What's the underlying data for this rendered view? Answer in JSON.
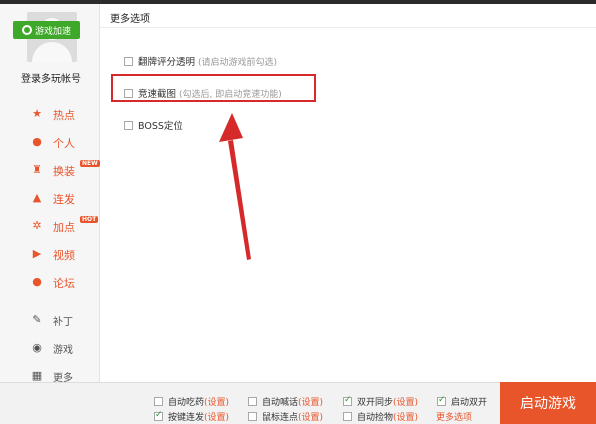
{
  "sidebar": {
    "login_label": "登录多玩帐号",
    "items": [
      {
        "label": "热点",
        "icon": "star-icon",
        "glyph": "★"
      },
      {
        "label": "个人",
        "icon": "person-icon",
        "glyph": "●"
      },
      {
        "label": "换装",
        "icon": "shirt-icon",
        "glyph": "♜",
        "badge": "NEW"
      },
      {
        "label": "连发",
        "icon": "triangle-icon",
        "glyph": "▲"
      },
      {
        "label": "加点",
        "icon": "crosshair-icon",
        "glyph": "✲",
        "badge": "HOT"
      },
      {
        "label": "视频",
        "icon": "play-icon",
        "glyph": "▶"
      },
      {
        "label": "论坛",
        "icon": "chat-icon",
        "glyph": "●"
      },
      {
        "label": "补丁",
        "icon": "wrench-icon",
        "glyph": "✎"
      },
      {
        "label": "游戏",
        "icon": "gamepad-icon",
        "glyph": "◉"
      },
      {
        "label": "更多",
        "icon": "grid-icon",
        "glyph": "▦"
      }
    ]
  },
  "content": {
    "title": "更多选项",
    "options": [
      {
        "label": "翻牌评分透明",
        "hint": "(请启动游戏前勾选)",
        "checked": false
      },
      {
        "label": "竞速截图",
        "hint": "(勾选后, 即启动竞速功能)",
        "checked": false
      },
      {
        "label": "BOSS定位",
        "hint": "",
        "checked": false
      }
    ]
  },
  "bottom": {
    "accel_label": "游戏加速",
    "options_row1": [
      {
        "label": "自动吃药",
        "set": "(设置)",
        "checked": false
      },
      {
        "label": "自动喊话",
        "set": "(设置)",
        "checked": false
      },
      {
        "label": "双开同步",
        "set": "(设置)",
        "checked": true
      },
      {
        "label": "启动双开",
        "set": "",
        "checked": true
      }
    ],
    "options_row2": [
      {
        "label": "按键连发",
        "set": "(设置)",
        "checked": true
      },
      {
        "label": "鼠标连点",
        "set": "(设置)",
        "checked": false
      },
      {
        "label": "自动捡物",
        "set": "(设置)",
        "checked": false
      }
    ],
    "more_label": "更多选项",
    "start_label": "启动游戏"
  },
  "colors": {
    "accent": "#e8552b",
    "highlight": "#d62a2a",
    "green": "#3fa82a"
  }
}
